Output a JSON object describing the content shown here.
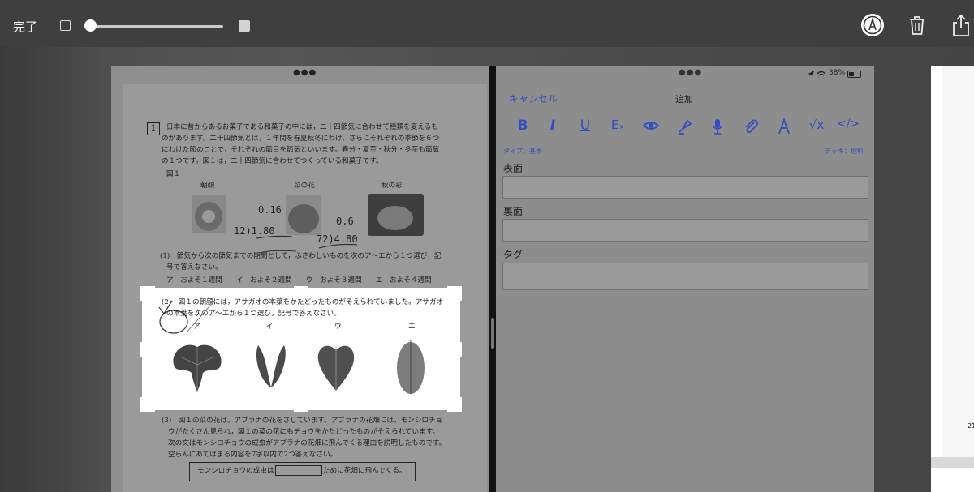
{
  "toolbar": {
    "done_label": "完了",
    "icons": [
      "checkbox-small",
      "opacity-slider",
      "checkbox-large",
      "markup-pen-icon",
      "trash-icon",
      "share-icon"
    ]
  },
  "pdf": {
    "question_number": "1",
    "intro_lines": [
      "日本に昔からあるお菓子である和菓子の中には，二十四節気に合わせて種類を変えるも",
      "のがあります。二十四節気とは，１年間を春夏秋冬にわけ，さらにそれぞれの季節を６つ",
      "にわけた節のことで，それぞれの節目を節気といいます。春分・夏至・秋分・冬至も節気",
      "の１つです。図１は，二十四節気に合わせてつくっている和菓子です。"
    ],
    "figure1_label": "図１",
    "sweets": [
      "朝顔",
      "菜の花",
      "秋の彩"
    ],
    "q1_lines": [
      "(1)　節気から次の節気までの期間として，ふさわしいものを次のア～エから１つ選び，記",
      "号で答えなさい。"
    ],
    "q1_choices": "ア　およそ１週間　　イ　およそ２週間　　ウ　およそ３週間　　エ　およそ４週間",
    "q2_lines": [
      "(2)　図１の朝顔には，アサガオの本葉をかたどったものがそえられていました。アサガオ",
      "の本葉を次のア～エから１つ選び，記号で答えなさい。"
    ],
    "leaf_labels": [
      "ア",
      "イ",
      "ウ",
      "エ"
    ],
    "q3_lines": [
      "(3)　図１の菜の花は，アブラナの花をさしています。アブラナの花畑には，モンシロチョ",
      "ウがたくさん見られ，図１の菜の花にもチョウをかたどったものがそえられています。",
      "次の文はモンシロチョウの成虫がアブラナの花畑に飛んでくる理由を説明したものです。",
      "空らんにあてはまる内容を7字以内で2つ答えなさい。"
    ],
    "answer_sentence_prefix": "モンシロチョウの成虫は",
    "answer_sentence_suffix": "ために花畑に飛んでくる。",
    "handwritten": [
      "0.16",
      "12)1.80",
      "0.6",
      "72)4.80"
    ]
  },
  "form": {
    "status": {
      "battery": "38%"
    },
    "cancel_label": "キャンセル",
    "title": "追加",
    "format_buttons": [
      "B",
      "I",
      "U",
      "Eₓ",
      "eye",
      "highlighter",
      "mic",
      "paperclip",
      "ink",
      "√x",
      "</>"
    ],
    "type_label": "タイプ：基本",
    "deck_label": "デッキ：理科",
    "fields": [
      {
        "label": "表面",
        "value": ""
      },
      {
        "label": "裏面",
        "value": ""
      },
      {
        "label": "タグ",
        "value": ""
      }
    ]
  },
  "right_page": {
    "partial_number": "21"
  },
  "colors": {
    "accent": "#2d4ec2",
    "toolbar": "#3f3f3f"
  }
}
